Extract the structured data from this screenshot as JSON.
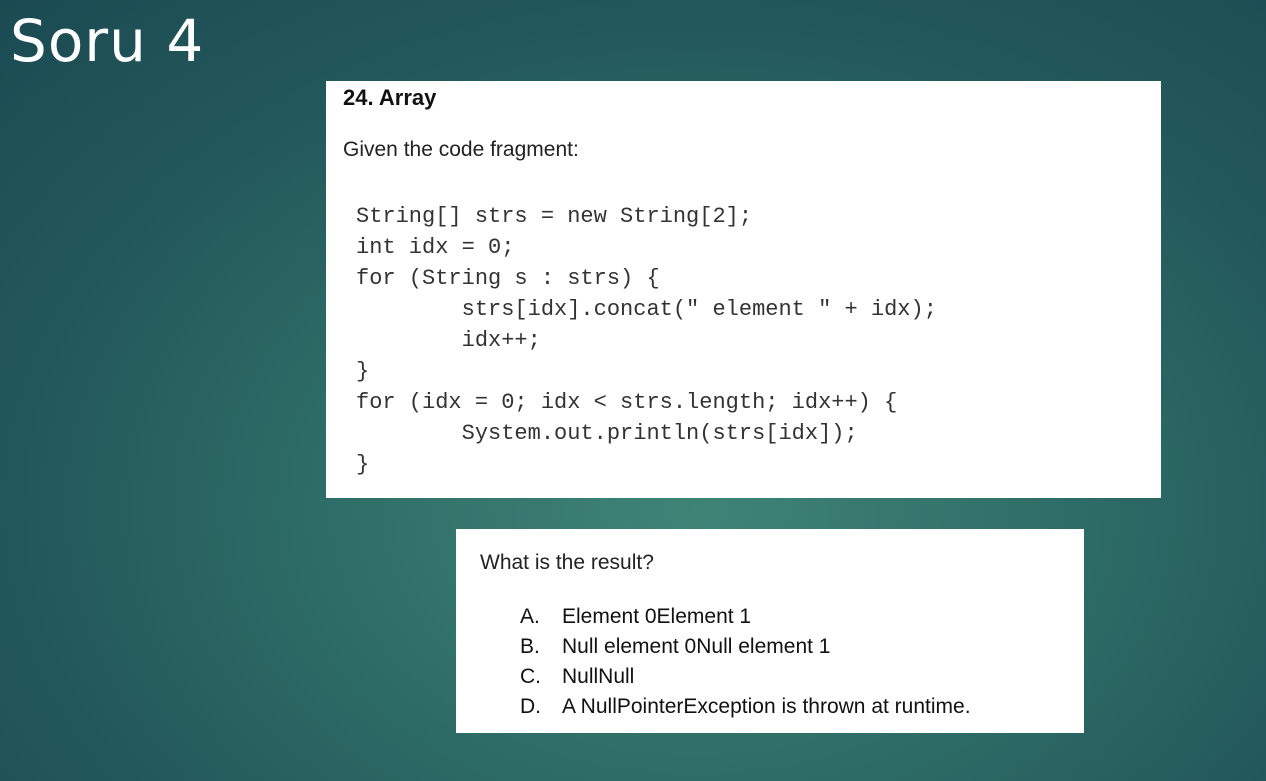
{
  "slide": {
    "title": "Soru 4"
  },
  "question": {
    "heading": "24. Array",
    "intro": "Given the code fragment:",
    "code": "String[] strs = new String[2];\nint idx = 0;\nfor (String s : strs) {\n        strs[idx].concat(\" element \" + idx);\n        idx++;\n}\nfor (idx = 0; idx < strs.length; idx++) {\n        System.out.println(strs[idx]);\n}"
  },
  "answers": {
    "prompt": "What is the result?",
    "options": [
      {
        "letter": "A.",
        "text": "Element 0Element 1"
      },
      {
        "letter": "B.",
        "text": "Null element 0Null element 1"
      },
      {
        "letter": "C.",
        "text": "NullNull"
      },
      {
        "letter": "D.",
        "text": "A NullPointerException is thrown at runtime."
      }
    ]
  },
  "colors": {
    "background_center": "#3f8377",
    "background_edge": "#1b4a52",
    "card": "#ffffff"
  }
}
